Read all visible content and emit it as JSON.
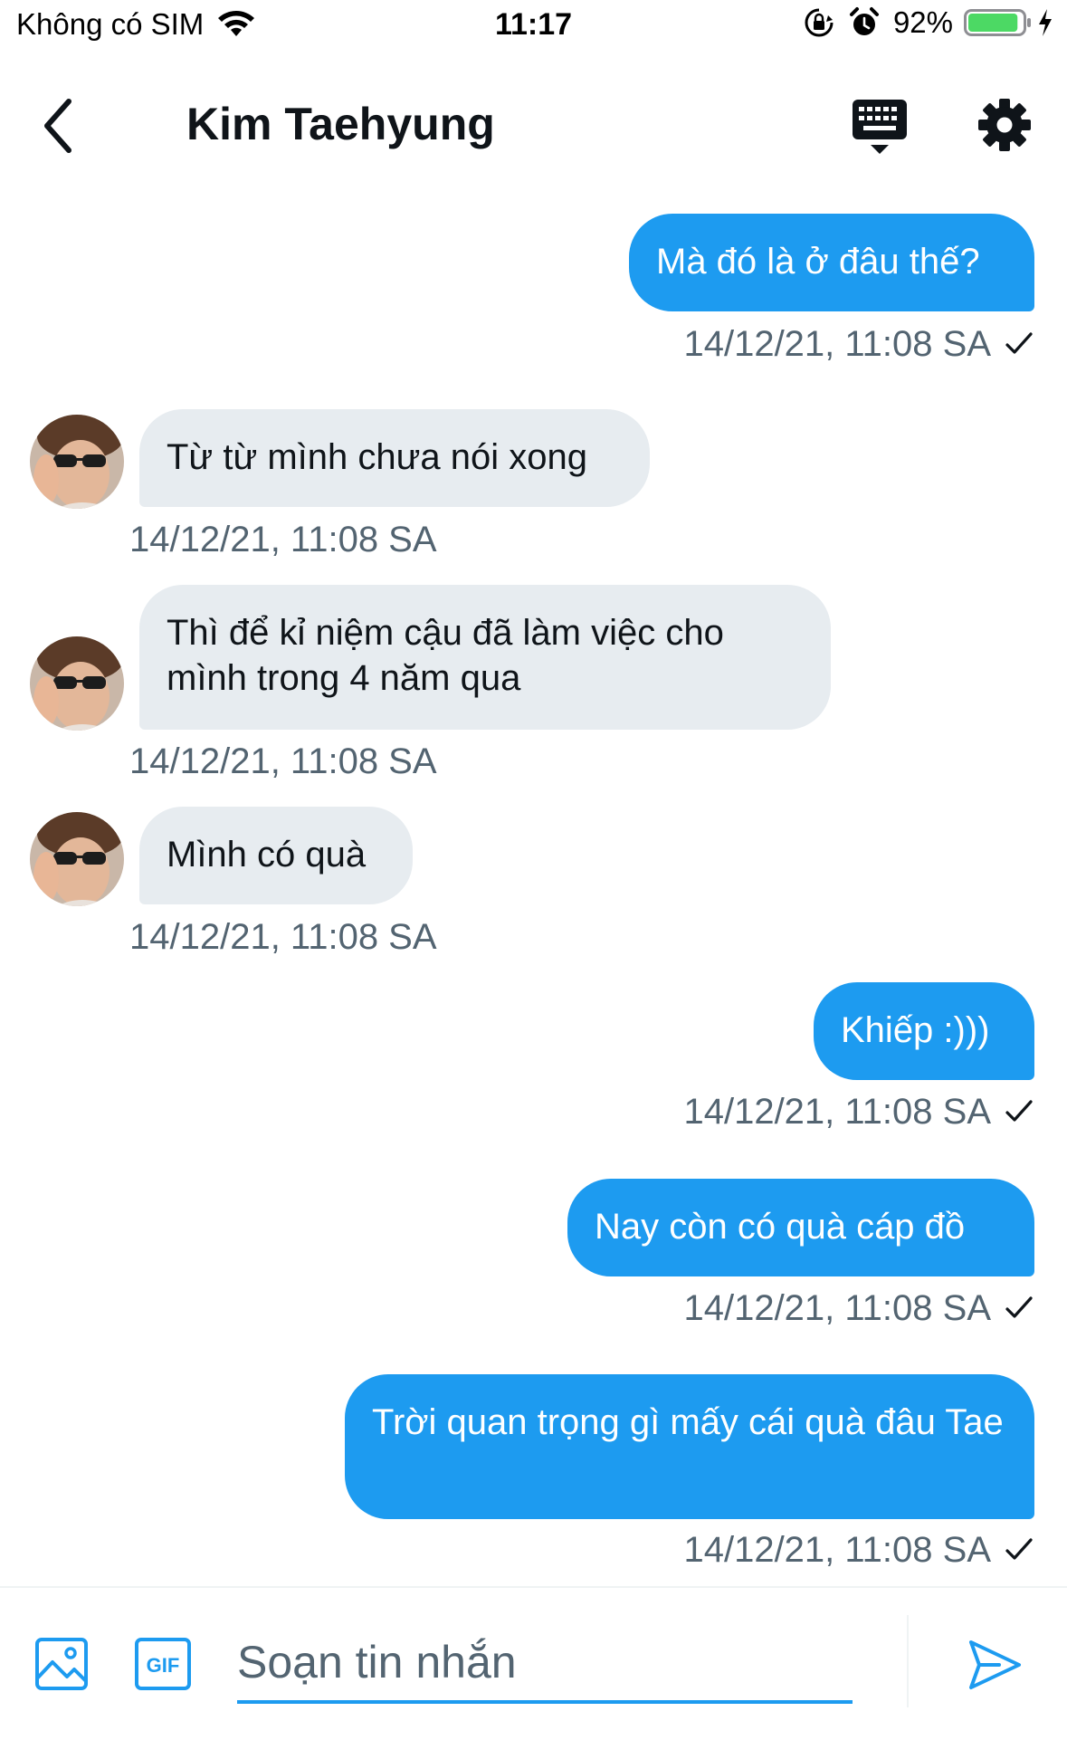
{
  "status_bar": {
    "carrier": "Không có SIM",
    "time": "11:17",
    "battery_percent": "92%",
    "battery_level": 0.92,
    "battery_color": "#4cd964"
  },
  "header": {
    "title": "Kim Taehyung",
    "icons": [
      "back-arrow-icon",
      "keyboard-icon",
      "gear-icon"
    ]
  },
  "colors": {
    "accent": "#1d9bf0",
    "received_bubble": "#e7ecf0",
    "timestamp": "#536471"
  },
  "messages": [
    {
      "direction": "sent",
      "text": "Mà đó là ở đâu thế?",
      "time": "14/12/21, 11:08 SA",
      "read_check": true
    },
    {
      "direction": "received",
      "text": "Từ từ mình chưa nói xong",
      "time": "14/12/21, 11:08 SA"
    },
    {
      "direction": "received",
      "text": "Thì để kỉ niệm cậu đã làm việc cho mình trong 4 năm qua",
      "time": "14/12/21, 11:08 SA"
    },
    {
      "direction": "received",
      "text": "Mình có quà",
      "time": "14/12/21, 11:08 SA"
    },
    {
      "direction": "sent",
      "text": "Khiếp :)))",
      "time": "14/12/21, 11:08 SA",
      "read_check": true
    },
    {
      "direction": "sent",
      "text": "Nay còn có quà cáp đồ",
      "time": "14/12/21, 11:08 SA",
      "read_check": true
    },
    {
      "direction": "sent",
      "text": "Trời quan trọng gì mấy cái quà đâu Tae",
      "time": "14/12/21, 11:08 SA",
      "read_check": true
    }
  ],
  "composer": {
    "placeholder": "Soạn tin nhắn",
    "value": "",
    "gif_label": "GIF",
    "icons": [
      "image-icon",
      "gif-icon",
      "send-icon"
    ]
  }
}
